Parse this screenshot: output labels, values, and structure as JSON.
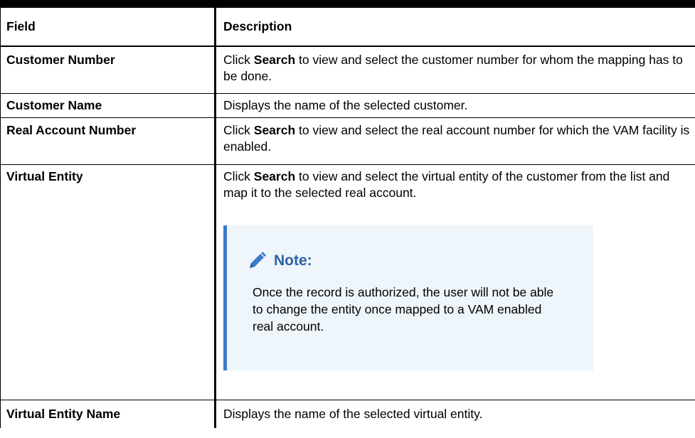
{
  "table": {
    "headers": {
      "field": "Field",
      "description": "Description"
    },
    "rows": [
      {
        "field": "Customer Number",
        "desc_pre": "Click ",
        "desc_bold": "Search",
        "desc_post": " to view and select the customer number for whom the mapping has to be done."
      },
      {
        "field": "Customer Name",
        "desc": "Displays the name of the selected customer."
      },
      {
        "field": "Real Account Number",
        "desc_pre": "Click ",
        "desc_bold": "Search",
        "desc_post": " to view and select the real account number for which the VAM facility is enabled."
      },
      {
        "field": "Virtual Entity",
        "desc_pre": "Click ",
        "desc_bold": "Search",
        "desc_post": " to view and select the virtual entity of the customer from the list and map it to the selected real account.",
        "note": {
          "icon": "pencil-icon",
          "title": "Note:",
          "text": "Once the record is authorized, the user will not be able to change the entity once mapped to a VAM enabled real account."
        }
      },
      {
        "field": "Virtual Entity Name",
        "desc": "Displays the name of the selected virtual entity."
      }
    ]
  },
  "colors": {
    "note_accent": "#3a7bc8",
    "note_background": "#eef5fb",
    "note_title": "#2a62a6"
  }
}
